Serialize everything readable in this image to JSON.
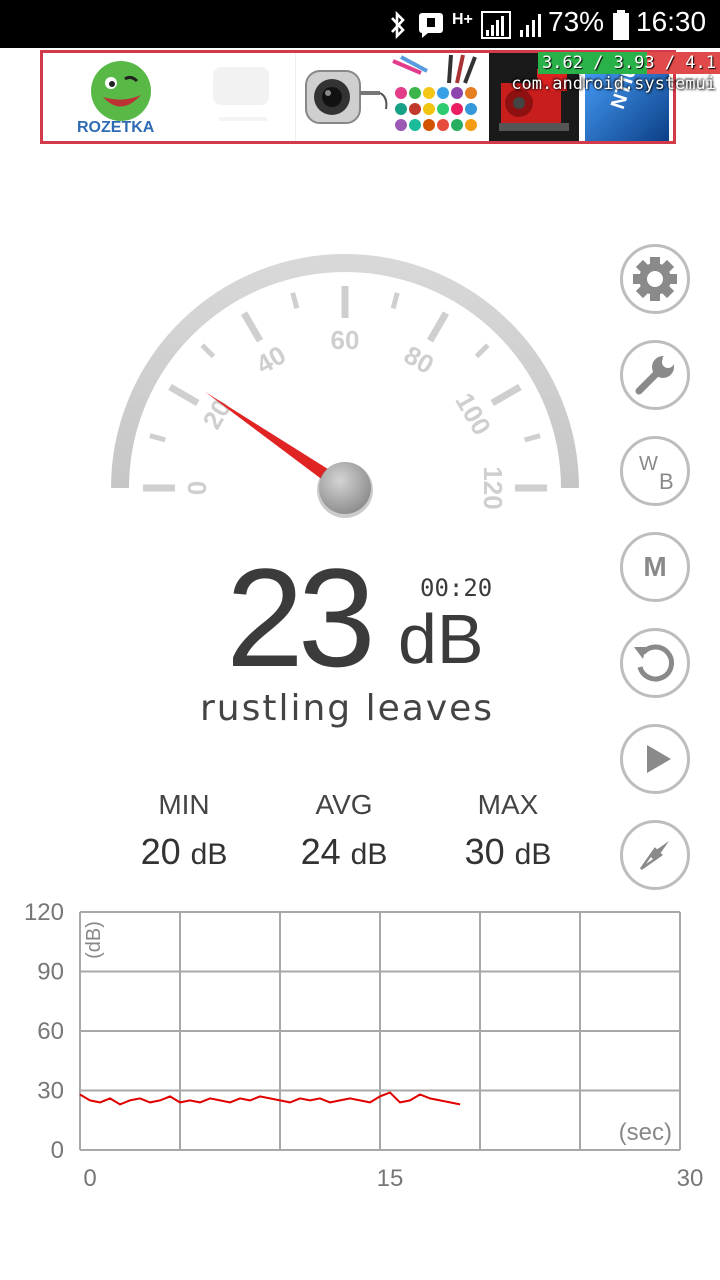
{
  "status_bar": {
    "network": "H+",
    "battery_percent": "73%",
    "time": "16:30"
  },
  "ad_banner": {
    "brand": "ROZETKA",
    "tiles": [
      "rozetka-logo",
      "car-camera",
      "cosmetics",
      "engine",
      "intel-box"
    ],
    "tile_text": "NTIUM"
  },
  "cpu_overlay": {
    "load": "3.62 / 3.93 / 4.1",
    "process": "com.android.systemui"
  },
  "gauge": {
    "min": 0,
    "max": 120,
    "ticks_labels": [
      "0",
      "20",
      "40",
      "60",
      "80",
      "100",
      "120"
    ],
    "needle_value": 23
  },
  "reading": {
    "value": "23",
    "unit": "dB",
    "timer": "00:20",
    "description": "rustling leaves"
  },
  "stats": {
    "min_label": "MIN",
    "min_value": "20",
    "avg_label": "AVG",
    "avg_value": "24",
    "max_label": "MAX",
    "max_value": "30",
    "unit": "dB"
  },
  "side_buttons": [
    "settings-icon",
    "wrench-icon",
    "white-balance-icon",
    "memory-icon",
    "reset-icon",
    "play-icon",
    "compass-icon"
  ],
  "side_button_text": {
    "wb_w": "W",
    "wb_b": "B",
    "m": "M"
  },
  "chart_data": {
    "type": "line",
    "ylabel": "(dB)",
    "xlabel": "(sec)",
    "xlim": [
      0,
      30
    ],
    "ylim": [
      0,
      120
    ],
    "x_ticks": [
      "0",
      "15",
      "30"
    ],
    "y_ticks": [
      "0",
      "30",
      "60",
      "90",
      "120"
    ],
    "grid": true,
    "series": [
      {
        "color": "#e00000",
        "x": [
          0,
          0.5,
          1,
          1.5,
          2,
          2.5,
          3,
          3.5,
          4,
          4.5,
          5,
          5.5,
          6,
          6.5,
          7,
          7.5,
          8,
          8.5,
          9,
          9.5,
          10,
          10.5,
          11,
          11.5,
          12,
          12.5,
          13,
          13.5,
          14,
          14.5,
          15,
          15.5,
          16,
          16.5,
          17,
          17.5,
          18,
          18.5,
          19
        ],
        "values": [
          28,
          25,
          24,
          26,
          23,
          25,
          26,
          24,
          25,
          27,
          24,
          25,
          24,
          26,
          25,
          24,
          26,
          25,
          27,
          26,
          25,
          24,
          26,
          25,
          26,
          24,
          25,
          26,
          25,
          24,
          27,
          29,
          24,
          25,
          28,
          26,
          25,
          24,
          23
        ]
      }
    ]
  }
}
